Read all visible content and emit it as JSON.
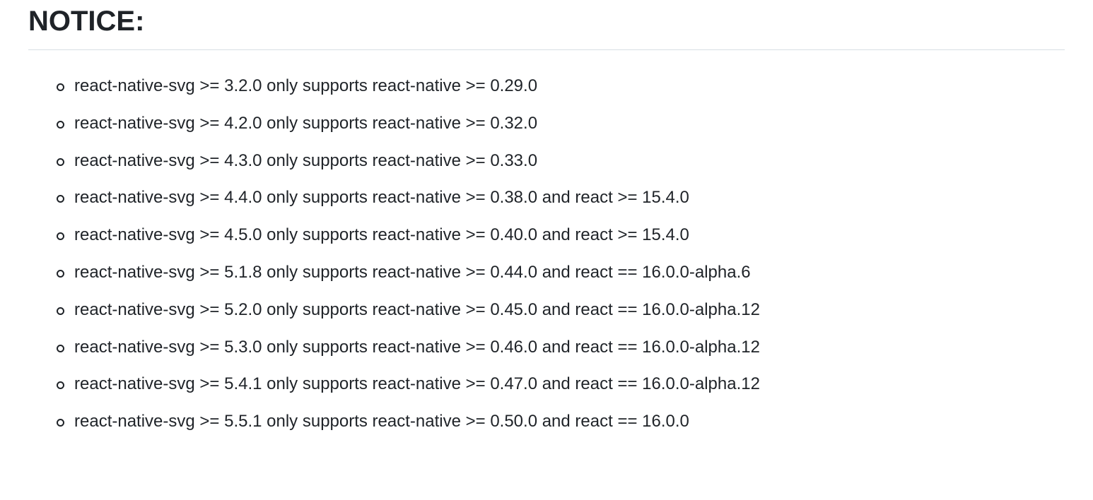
{
  "heading": "NOTICE:",
  "items": [
    "react-native-svg >= 3.2.0 only supports react-native >= 0.29.0",
    "react-native-svg >= 4.2.0 only supports react-native >= 0.32.0",
    "react-native-svg >= 4.3.0 only supports react-native >= 0.33.0",
    "react-native-svg >= 4.4.0 only supports react-native >= 0.38.0 and react >= 15.4.0",
    "react-native-svg >= 4.5.0 only supports react-native >= 0.40.0 and react >= 15.4.0",
    "react-native-svg >= 5.1.8 only supports react-native >= 0.44.0 and react == 16.0.0-alpha.6",
    "react-native-svg >= 5.2.0 only supports react-native >= 0.45.0 and react == 16.0.0-alpha.12",
    "react-native-svg >= 5.3.0 only supports react-native >= 0.46.0 and react == 16.0.0-alpha.12",
    "react-native-svg >= 5.4.1 only supports react-native >= 0.47.0 and react == 16.0.0-alpha.12",
    "react-native-svg >= 5.5.1 only supports react-native >= 0.50.0 and react == 16.0.0"
  ]
}
